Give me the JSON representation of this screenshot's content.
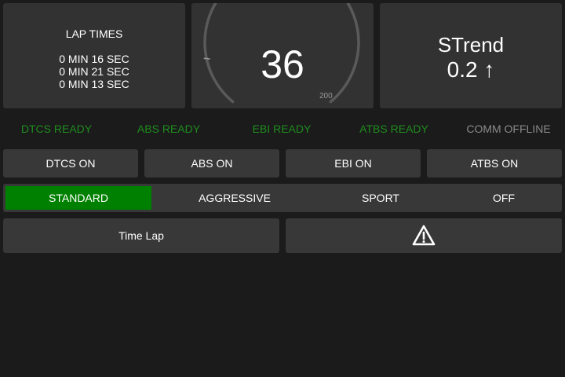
{
  "lap_times": {
    "title": "LAP TIMES",
    "entries": [
      "0 MIN 16 SEC",
      "0 MIN 21 SEC",
      "0 MIN 13 SEC"
    ]
  },
  "gauge": {
    "speed": "36",
    "max_label": "200",
    "value": 36,
    "max": 200
  },
  "trend": {
    "title": "STrend",
    "value": "0.2 ↑"
  },
  "status": {
    "dtcs": "DTCS READY",
    "abs": "ABS READY",
    "ebi": "EBI READY",
    "atbs": "ATBS READY",
    "comm": "COMM OFFLINE"
  },
  "colors": {
    "ready": "#1e8c1e",
    "offline": "#8a8a8a",
    "active_mode": "#008000"
  },
  "toggles": {
    "dtcs": "DTCS ON",
    "abs": "ABS ON",
    "ebi": "EBI ON",
    "atbs": "ATBS ON"
  },
  "modes": {
    "selected": "STANDARD",
    "standard": "STANDARD",
    "aggressive": "AGGRESSIVE",
    "sport": "SPORT",
    "off": "OFF"
  },
  "actions": {
    "time_lap": "Time Lap",
    "warning_icon": "warning-triangle-icon"
  }
}
